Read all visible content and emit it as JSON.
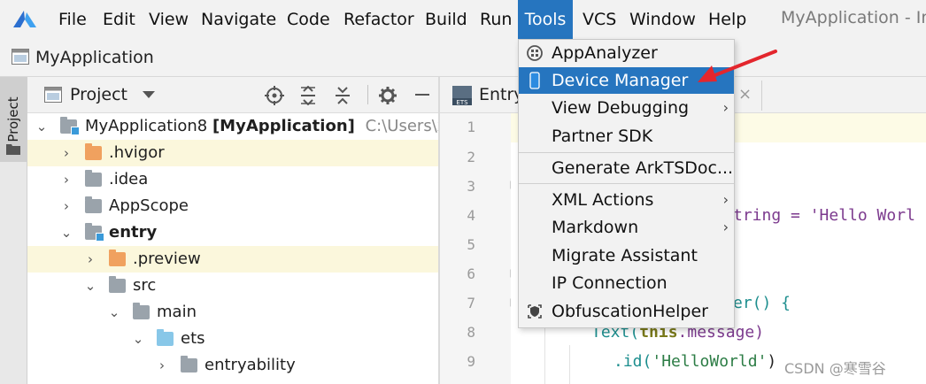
{
  "menubar": {
    "items": [
      "File",
      "Edit",
      "View",
      "Navigate",
      "Code",
      "Refactor",
      "Build",
      "Run",
      "Tools",
      "VCS",
      "Window",
      "Help"
    ],
    "active": "Tools",
    "window_title": "MyApplication - Inc"
  },
  "breadcrumb": {
    "label": "MyApplication"
  },
  "tool_strip": {
    "project_tab": "Project"
  },
  "project_panel": {
    "title": "Project",
    "tree": [
      {
        "label": "MyApplication8",
        "bold_suffix": "[MyApplication]",
        "path": "C:\\Users\\xiu"
      },
      {
        "label": ".hvigor"
      },
      {
        "label": ".idea"
      },
      {
        "label": "AppScope"
      },
      {
        "label": "entry"
      },
      {
        "label": ".preview"
      },
      {
        "label": "src"
      },
      {
        "label": "main"
      },
      {
        "label": "ets"
      },
      {
        "label": "entryability"
      }
    ]
  },
  "editor": {
    "tab_label": "Entry",
    "tab_close": "×",
    "line_numbers": [
      "1",
      "2",
      "3",
      "4",
      "5",
      "6",
      "7",
      "8",
      "9"
    ],
    "code": {
      "l4_fragment": "tring = 'Hello Worl",
      "l7_fragment": "er() {",
      "l8_a": "Text(",
      "l8_b": "this",
      "l8_c": ".message)",
      "l9_a": ".id(",
      "l9_b": "'HelloWorld'",
      "l9_c": ")"
    }
  },
  "tools_menu": {
    "items": [
      {
        "label": "AppAnalyzer",
        "icon": "app-analyzer-icon"
      },
      {
        "label": "Device Manager",
        "icon": "device-phone-icon",
        "selected": true
      },
      {
        "label": "View Debugging",
        "submenu": true
      },
      {
        "label": "Partner SDK"
      },
      {
        "label": "Generate ArkTSDoc..."
      },
      {
        "label": "XML Actions",
        "submenu": true
      },
      {
        "label": "Markdown",
        "submenu": true
      },
      {
        "label": "Migrate Assistant"
      },
      {
        "label": "IP Connection"
      },
      {
        "label": "ObfuscationHelper",
        "icon": "shield-icon"
      }
    ],
    "submenu_glyph": "›"
  },
  "watermark": "CSDN @寒雪谷",
  "colors": {
    "selection": "#2675bf",
    "annotation_arrow": "#e3262d"
  }
}
